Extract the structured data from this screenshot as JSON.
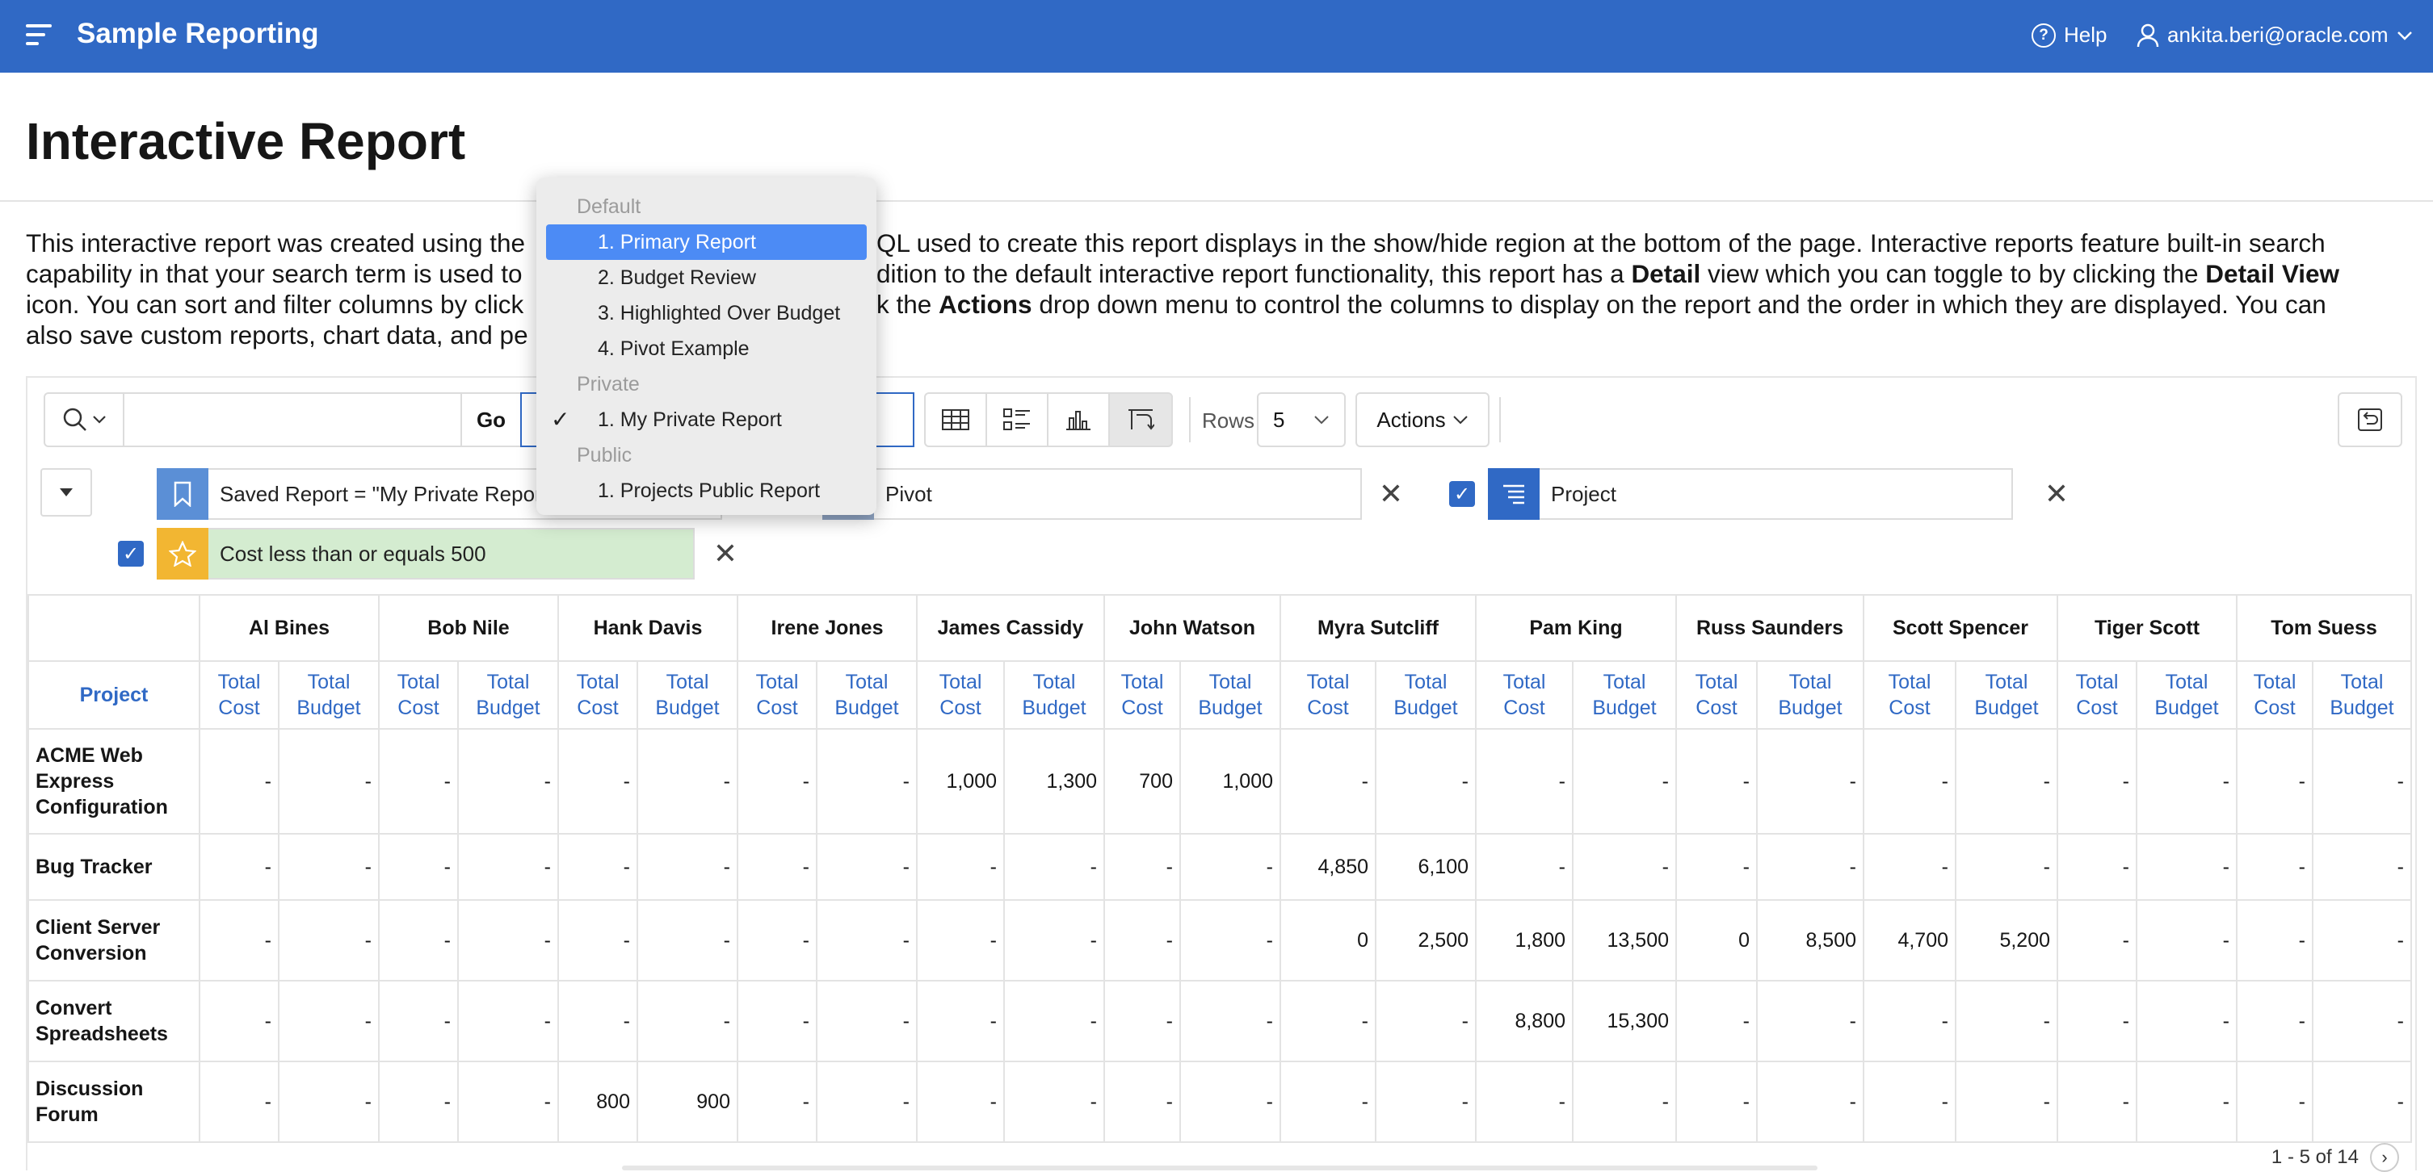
{
  "header": {
    "app_title": "Sample Reporting",
    "help_label": "Help",
    "user_label": "ankita.beri@oracle.com",
    "menu_icon": "hamburger-icon",
    "help_icon": "help-circle-icon",
    "user_icon": "user-icon"
  },
  "page": {
    "title": "Interactive Report"
  },
  "description": {
    "line1a": "This interactive report was created using the ",
    "line1b": "QL used to create this report displays in the show/hide region at the bottom of the page. Interactive reports feature built-in search",
    "line2a": "capability in that your search term is used to",
    "line2b": "dition to the default interactive report functionality, this report has a ",
    "line2c": "Detail",
    "line2d": " view which you can toggle to by clicking the ",
    "line2e": "Detail View",
    "line3a": "icon. You can sort and filter columns by click",
    "line3b": "k the ",
    "line3c": "Actions",
    "line3d": " drop down menu to control the columns to display on the report and the order in which they are displayed. You can",
    "line4a": "also save custom reports, chart data, and pe"
  },
  "toolbar": {
    "search_value": "",
    "go_label": "Go",
    "rows_label": "Rows",
    "rows_value": "5",
    "actions_label": "Actions"
  },
  "filters": {
    "saved_report": "Saved Report = \"My Private Report",
    "pivot": "Pivot",
    "project": "Project",
    "highlight": "Cost less than or equals 500"
  },
  "report_menu": {
    "groups": [
      {
        "label": "Default",
        "items": [
          "1. Primary Report",
          "2. Budget Review",
          "3. Highlighted Over Budget",
          "4. Pivot Example"
        ]
      },
      {
        "label": "Private",
        "items": [
          "1. My Private Report"
        ]
      },
      {
        "label": "Public",
        "items": [
          "1. Projects Public Report"
        ]
      }
    ],
    "highlighted": "1. Primary Report",
    "checked": "1. My Private Report"
  },
  "table": {
    "project_header": "Project",
    "sub_cost": "Total Cost",
    "sub_budget": "Total Budget",
    "people": [
      "Al Bines",
      "Bob Nile",
      "Hank Davis",
      "Irene Jones",
      "James Cassidy",
      "John Watson",
      "Myra Sutcliff",
      "Pam King",
      "Russ Saunders",
      "Scott Spencer",
      "Tiger Scott",
      "Tom Suess"
    ],
    "rows": [
      {
        "project": "ACME Web Express Configuration",
        "values": [
          "-",
          "-",
          "-",
          "-",
          "-",
          "-",
          "-",
          "-",
          "1,000",
          "1,300",
          "700",
          "1,000",
          "-",
          "-",
          "-",
          "-",
          "-",
          "-",
          "-",
          "-",
          "-",
          "-",
          "-",
          "-"
        ]
      },
      {
        "project": "Bug Tracker",
        "values": [
          "-",
          "-",
          "-",
          "-",
          "-",
          "-",
          "-",
          "-",
          "-",
          "-",
          "-",
          "-",
          "4,850",
          "6,100",
          "-",
          "-",
          "-",
          "-",
          "-",
          "-",
          "-",
          "-",
          "-",
          "-"
        ]
      },
      {
        "project": "Client Server Conversion",
        "values": [
          "-",
          "-",
          "-",
          "-",
          "-",
          "-",
          "-",
          "-",
          "-",
          "-",
          "-",
          "-",
          "0",
          "2,500",
          "1,800",
          "13,500",
          "0",
          "8,500",
          "4,700",
          "5,200",
          "-",
          "-",
          "-",
          "-"
        ]
      },
      {
        "project": "Convert Spreadsheets",
        "values": [
          "-",
          "-",
          "-",
          "-",
          "-",
          "-",
          "-",
          "-",
          "-",
          "-",
          "-",
          "-",
          "-",
          "-",
          "8,800",
          "15,300",
          "-",
          "-",
          "-",
          "-",
          "-",
          "-",
          "-",
          "-"
        ]
      },
      {
        "project": "Discussion Forum",
        "values": [
          "-",
          "-",
          "-",
          "-",
          "800",
          "900",
          "-",
          "-",
          "-",
          "-",
          "-",
          "-",
          "-",
          "-",
          "-",
          "-",
          "-",
          "-",
          "-",
          "-",
          "-",
          "-",
          "-",
          "-"
        ]
      }
    ]
  },
  "pagination": {
    "label": "1 - 5 of 14"
  }
}
